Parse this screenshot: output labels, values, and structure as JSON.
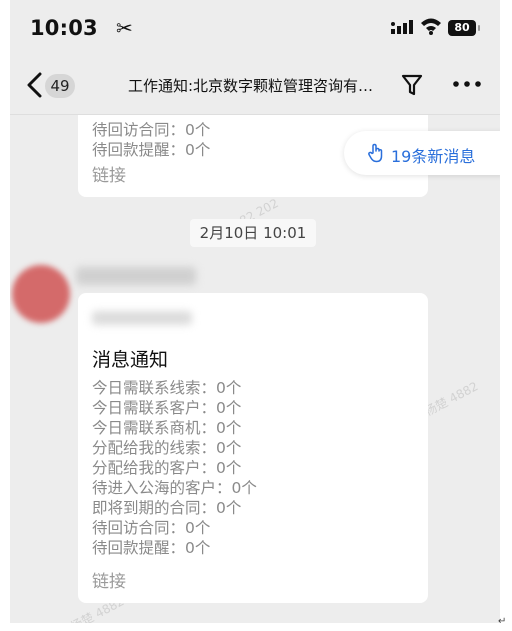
{
  "status_bar": {
    "time": "10:03",
    "tool_glyph": "✂",
    "battery": "80"
  },
  "nav": {
    "unread_count": "49",
    "title": "工作通知:北京数字颗粒管理咨询有…"
  },
  "new_messages": "19条新消息",
  "card1": {
    "lines": [
      "待回访合同：0个",
      "待回款提醒：0个"
    ],
    "link": "链接"
  },
  "date_label": "2月10日 10:01",
  "card2": {
    "title": "消息通知",
    "lines": [
      "今日需联系线索：0个",
      "今日需联系客户：0个",
      "今日需联系商机：0个",
      "分配给我的线索：0个",
      "分配给我的客户：0个",
      "待进入公海的客户：0个",
      "即将到期的合同：0个",
      "待回访合同：0个",
      "待回款提醒：0个"
    ],
    "link": "链接"
  },
  "watermarks": [
    "杨楚 4882",
    "杨楚 4882",
    "82 202"
  ],
  "corner_mark": "↵",
  "colors": {
    "accent": "#2a6fdb",
    "background": "#ededed",
    "card": "#ffffff"
  }
}
